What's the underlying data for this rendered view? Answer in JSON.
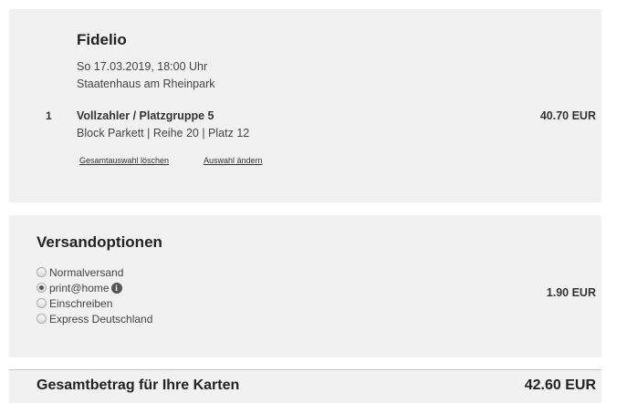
{
  "event": {
    "title": "Fidelio",
    "date": "So 17.03.2019, 18:00 Uhr",
    "venue": "Staatenhaus am Rheinpark",
    "ticket": {
      "qty": "1",
      "category": "Vollzahler / Platzgruppe 5",
      "seat": "Block Parkett | Reihe 20 | Platz 12",
      "price": "40.70 EUR"
    },
    "links": {
      "clear": "Gesamtauswahl löschen",
      "change": "Auswahl ändern"
    }
  },
  "shipping": {
    "title": "Versandoptionen",
    "options": [
      {
        "label": "Normalversand",
        "selected": false
      },
      {
        "label": "print@home",
        "selected": true
      },
      {
        "label": "Einschreiben",
        "selected": false
      },
      {
        "label": "Express Deutschland",
        "selected": false
      }
    ],
    "price": "1.90 EUR",
    "info_icon": "info-icon"
  },
  "total": {
    "label": "Gesamtbetrag für Ihre Karten",
    "value": "42.60 EUR"
  }
}
